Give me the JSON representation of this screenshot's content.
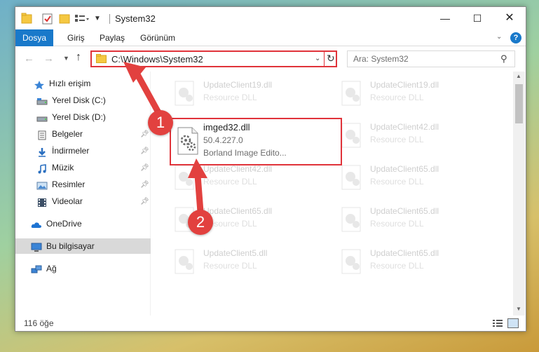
{
  "window": {
    "title": "System32"
  },
  "ribbon": {
    "tabs": [
      "Dosya",
      "Giriş",
      "Paylaş",
      "Görünüm"
    ],
    "help": "?"
  },
  "nav": {
    "address": "C:\\Windows\\System32",
    "search_placeholder": "Ara: System32"
  },
  "sidebar": {
    "items": [
      {
        "label": "Hızlı erişim",
        "icon": "star-icon"
      },
      {
        "label": "Yerel Disk (C:)",
        "icon": "drive-icon"
      },
      {
        "label": "Yerel Disk (D:)",
        "icon": "drive-icon"
      },
      {
        "label": "Belgeler",
        "icon": "documents-icon",
        "pinned": true
      },
      {
        "label": "İndirmeler",
        "icon": "download-icon",
        "pinned": true
      },
      {
        "label": "Müzik",
        "icon": "music-icon",
        "pinned": true
      },
      {
        "label": "Resimler",
        "icon": "pictures-icon",
        "pinned": true
      },
      {
        "label": "Videolar",
        "icon": "video-icon",
        "pinned": true
      },
      {
        "label": "OneDrive",
        "icon": "cloud-icon"
      },
      {
        "label": "Bu bilgisayar",
        "icon": "computer-icon",
        "selected": true
      },
      {
        "label": "Ağ",
        "icon": "network-icon"
      }
    ]
  },
  "files": {
    "highlighted": {
      "name": "imged32.dll",
      "version": "50.4.227.0",
      "description": "Borland Image Edito..."
    },
    "faded": [
      {
        "name": "UpdateClient19.dll",
        "type": "Resource DLL"
      },
      {
        "name": "UpdateClient19.dll",
        "type": "Resource DLL"
      },
      {
        "name": "UpdateClient42.dll",
        "type": "Resource DLL"
      },
      {
        "name": "UpdateClient42.dll",
        "type": "Resource DLL"
      },
      {
        "name": "UpdateClient65.dll",
        "type": "Resource DLL"
      },
      {
        "name": "UpdateClient65.dll",
        "type": "Resource DLL"
      },
      {
        "name": "UpdateClient65.dll",
        "type": "Resource DLL"
      },
      {
        "name": "UpdateClient5.dll",
        "type": "Resource DLL"
      },
      {
        "name": "UpdateClient65.dll",
        "type": "Resource DLL"
      }
    ]
  },
  "status": {
    "count": "116 öğe"
  },
  "annotations": {
    "step1": "1",
    "step2": "2",
    "color": "#e2413f"
  }
}
